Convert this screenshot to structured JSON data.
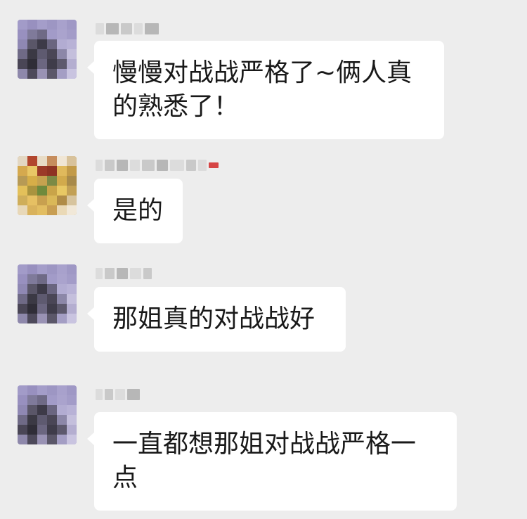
{
  "messages": [
    {
      "text": "慢慢对战战严格了~俩人真的熟悉了！"
    },
    {
      "text": "是的"
    },
    {
      "text": "那姐真的对战战好"
    },
    {
      "text": "一直都想那姐对战战严格一点"
    }
  ],
  "colors": {
    "background": "#ededed",
    "bubble": "#ffffff",
    "text": "#191919",
    "avatar_purple": "#8e86b8",
    "avatar_floral": "#c9a354"
  }
}
